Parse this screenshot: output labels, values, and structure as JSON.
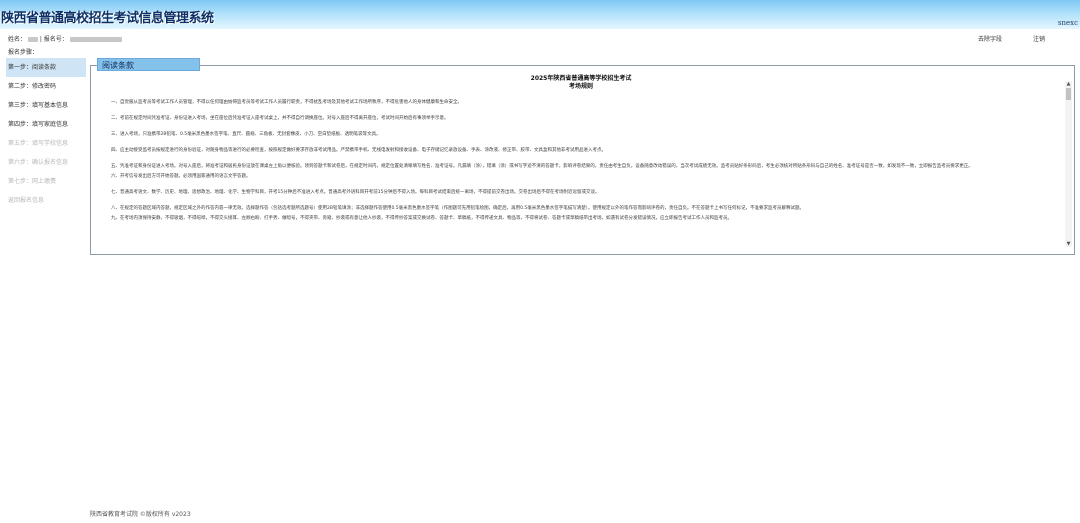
{
  "header": {
    "title": "陕西省普通高校招生考试信息管理系统",
    "username": "snexc"
  },
  "infobar": {
    "name_label": "姓名：",
    "exam_no_label": "| 报名号：",
    "nav1": "去除字段",
    "nav2": "注销"
  },
  "steps": {
    "title": "报名步骤：",
    "items": [
      {
        "label": "第一步：阅读条款",
        "state": "active"
      },
      {
        "label": "第二步：修改密码",
        "state": "enabled"
      },
      {
        "label": "第三步：填写基本信息",
        "state": "enabled"
      },
      {
        "label": "第四步：填写家庭信息",
        "state": "enabled"
      },
      {
        "label": "第五步：填写学校信息",
        "state": "disabled"
      },
      {
        "label": "第六步：确认报名信息",
        "state": "disabled"
      },
      {
        "label": "第七步：网上缴费",
        "state": "disabled"
      },
      {
        "label": "返回报名信息",
        "state": "disabled"
      }
    ]
  },
  "panel": {
    "legend": "阅读条款",
    "doc_title": "2025年陕西省普通高等学校招生考试",
    "doc_subtitle": "考场规则",
    "rules": [
      "一、自觉服从监考员等考试工作人员管理，不得以任何理由妨碍监考员等考试工作人员履行职责，不得扰乱考场及其他考试工作场所秩序，不得危害他人的身体健康和生命安全。",
      "二、考前在规定时间凭准考证、身份证进入考场，坐在座位后凭准考证入座考试桌上，并不得自行调换座位。对号入座后不得离开座位，考试时间开始后有事须举手示意。",
      "三、进入考场，只准携带2B铅笔、0.5毫米黑色墨水签字笔、直尺、圆规、三角板、无封套橡皮、小刀、空白垫纸板、透明笔袋等文具。",
      "四、应主动接受监考员按规定进行的身份验证，对随身物品等进行的必要检查，按照规定做好要求存放非考试用品。严禁携带手机、无线电发射和接收设备、电子存储记忆录放设备、手表、涂改液、修正带、胶带、文具盒和其他非考试用品进入考点。",
      "五、凭准考证和身份证进入考场。对号入座后，将准考证和居民身份证放在课桌左上角以便核验。领到答题卡和试卷后，在规定时间内，规定位置处清晰填写姓名、准考证号。凡漏填（涂），错填（涂）或书写字迹不清的答题卡，影响评卷结果的，责任由考生自负。设备随意改动错误的，当次考试成绩无效。监考员贴好条形码后，考生必须核对所贴条形码与自己的姓名、准考证号是否一致，如发现不一致，立即报告监考员要求更正。",
      "六、开考信号发出后方可开始答题。必须用国家通用的语言文字答题。",
      "七、普通高考语文、数学、历史、地理、思想政治、地理、化学、生物学科目，开考15分钟后不准进入考点。普通高考外语科目开考前15分钟后不得入场。每科目考试结束后统一离场，不得提前交卷出场。交卷出场后不得在考场附近逗留或交谈。",
      "八、在规定的答题区域内答题，规定区域之外的作答内容一律无效。选择题作答（包括选考题所选题号）使用2B铅笔填涂；非选择题作答使用0.5毫米黑色墨水签字笔（作图题可先用铅笔绘图，确定后，再用0.5毫米黑色墨水签字笔描写清楚）。使用规定以外的笔作答而影响评卷的，责任自负。不在答题卡上书写任何标记，不准要求监考员解释试题。",
      "九、在考场内须保持安静，不得吸烟，不得喧哗，不得交头接耳、左顾右盼、打手势、做暗号，不得夹带、旁窥、抄袭或有意让他人抄袭，不得传抄答案或交换试卷、答题卡、草稿纸，不得传递文具、物品等，不得将试卷、答题卡或草稿纸带出考场。如遇有试卷分发错误情况，应立即报告考试工作人员和监考员。"
    ]
  },
  "footer": {
    "copyright": "陕西省教育考试院 ©版权所有 v2023"
  },
  "colors": {
    "banner_top": "#7fc8f3",
    "banner_bottom": "#e4f6ff",
    "legend_bg": "#84c2ec",
    "active_step_bg": "#cfe4f4"
  }
}
